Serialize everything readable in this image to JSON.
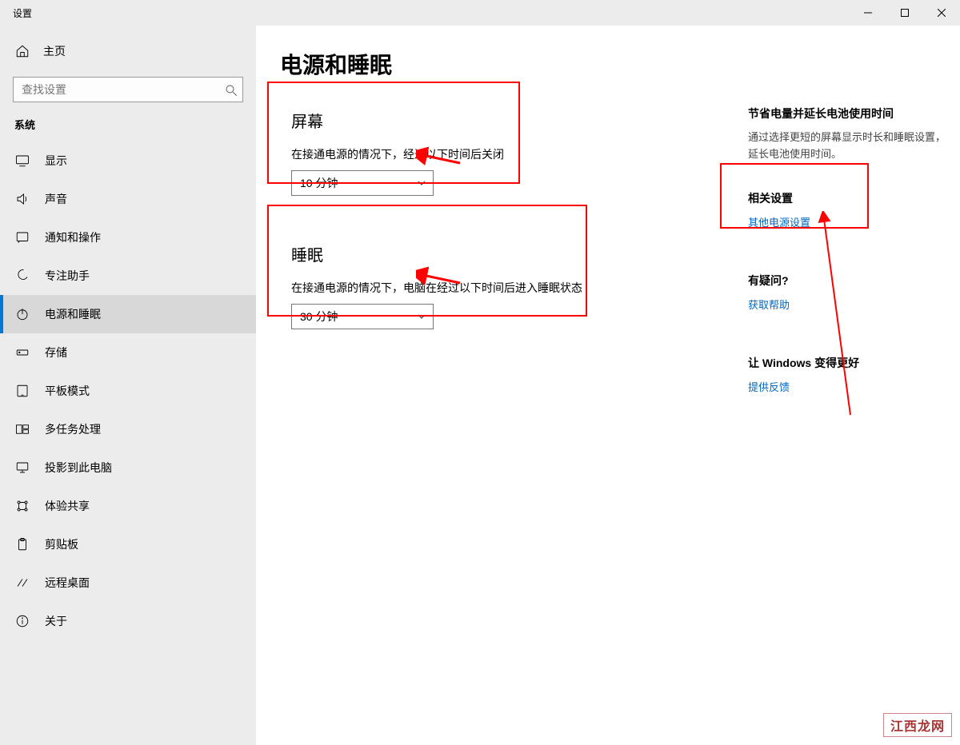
{
  "window": {
    "title": "设置"
  },
  "sidebar": {
    "home": "主页",
    "search_placeholder": "查找设置",
    "group_label": "系统",
    "items": [
      {
        "id": "display",
        "label": "显示"
      },
      {
        "id": "sound",
        "label": "声音"
      },
      {
        "id": "notifications",
        "label": "通知和操作"
      },
      {
        "id": "focus",
        "label": "专注助手"
      },
      {
        "id": "power",
        "label": "电源和睡眠",
        "active": true
      },
      {
        "id": "storage",
        "label": "存储"
      },
      {
        "id": "tablet",
        "label": "平板模式"
      },
      {
        "id": "multitask",
        "label": "多任务处理"
      },
      {
        "id": "projecting",
        "label": "投影到此电脑"
      },
      {
        "id": "shared",
        "label": "体验共享"
      },
      {
        "id": "clipboard",
        "label": "剪贴板"
      },
      {
        "id": "remote",
        "label": "远程桌面"
      },
      {
        "id": "about",
        "label": "关于"
      }
    ]
  },
  "page": {
    "title": "电源和睡眠",
    "screen": {
      "heading": "屏幕",
      "desc": "在接通电源的情况下，经过以下时间后关闭",
      "value": "10 分钟"
    },
    "sleep": {
      "heading": "睡眠",
      "desc": "在接通电源的情况下，电脑在经过以下时间后进入睡眠状态",
      "value": "30 分钟"
    }
  },
  "aside": {
    "power_saving_title": "节省电量并延长电池使用时间",
    "power_saving_text": "通过选择更短的屏幕显示时长和睡眠设置，延长电池使用时间。",
    "related_title": "相关设置",
    "related_link": "其他电源设置",
    "question_title": "有疑问?",
    "help_link": "获取帮助",
    "improve_title": "让 Windows 变得更好",
    "feedback_link": "提供反馈"
  },
  "watermark": "江西龙网"
}
